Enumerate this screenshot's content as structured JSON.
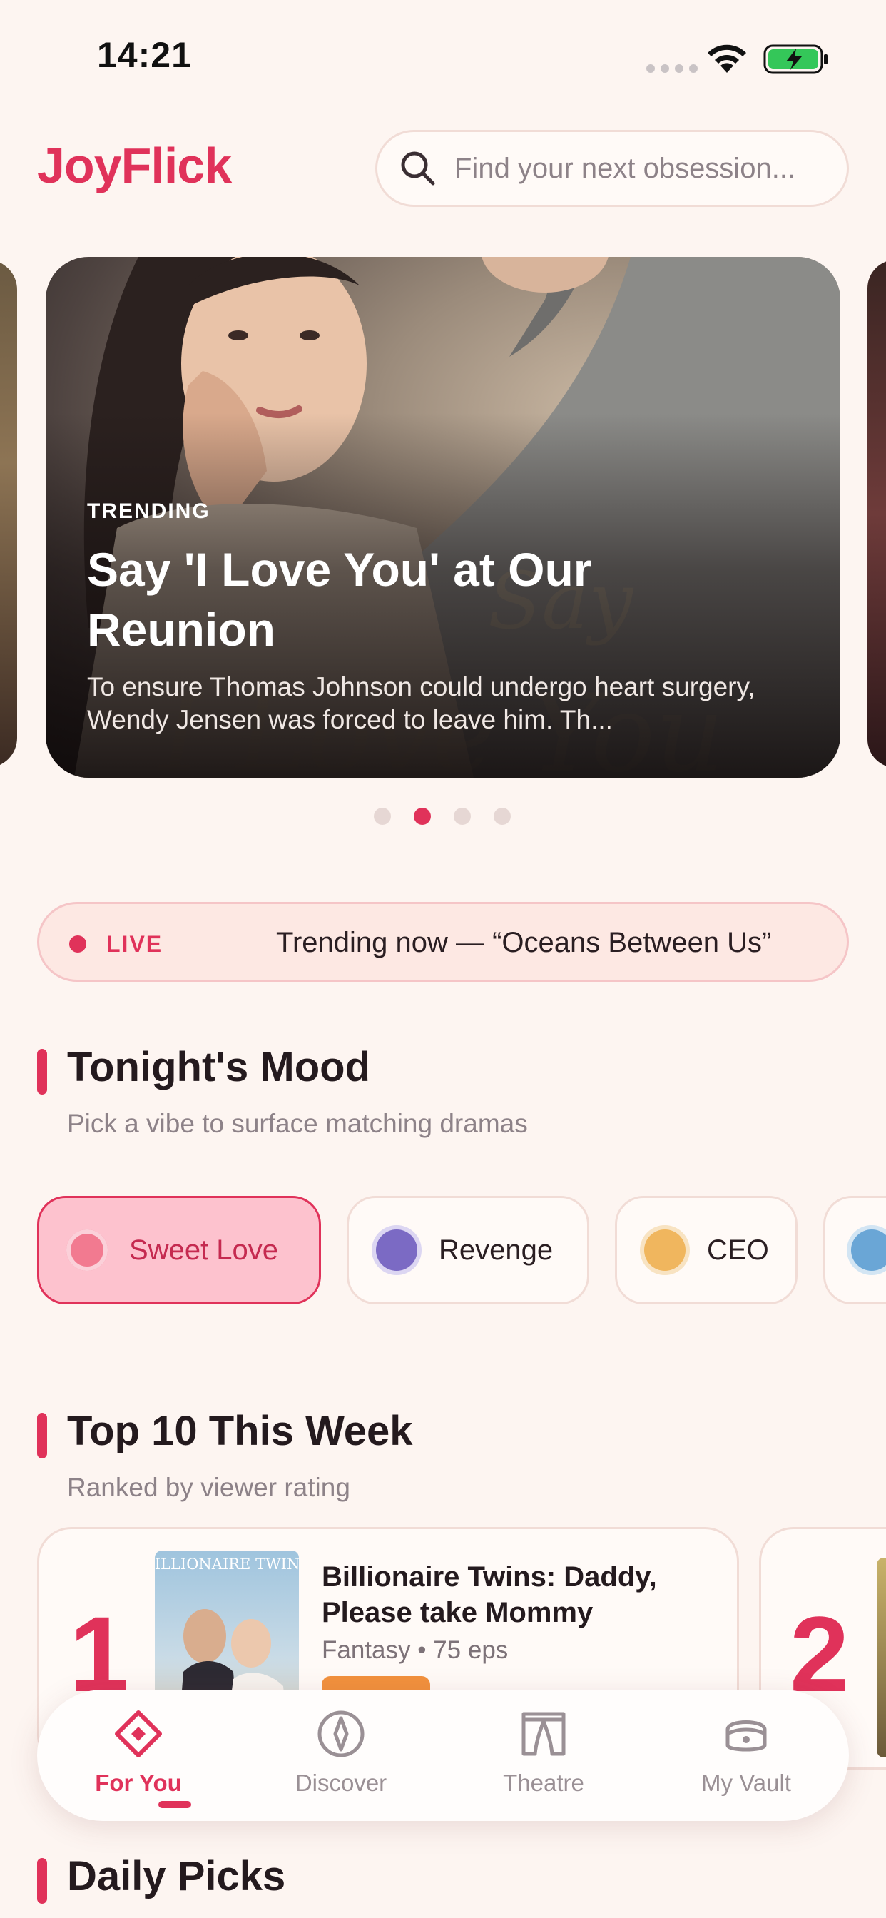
{
  "status_bar": {
    "time": "14:21"
  },
  "header": {
    "logo": "JoyFlick",
    "search_placeholder": "Find your next obsession..."
  },
  "hero": {
    "tag": "TRENDING",
    "title": "Say 'I Love You' at Our Reunion",
    "description": "To ensure Thomas Johnson could undergo heart surgery, Wendy Jensen was forced to leave him. Th...",
    "active_slide": 2,
    "slide_count": 4
  },
  "live": {
    "label": "LIVE",
    "text": "Trending now — “Oceans Between Us”"
  },
  "mood": {
    "title": "Tonight's Mood",
    "subtitle": "Pick a vibe to surface matching dramas",
    "chips": [
      {
        "label": "Sweet Love",
        "color": "#f27a90",
        "selected": true
      },
      {
        "label": "Revenge",
        "color": "#7b6ac4",
        "selected": false
      },
      {
        "label": "CEO",
        "color": "#f0b65e",
        "selected": false
      },
      {
        "label": "",
        "color": "#6aa6d6",
        "selected": false
      }
    ]
  },
  "top10": {
    "title": "Top 10 This Week",
    "subtitle": "Ranked by viewer rating",
    "items": [
      {
        "rank": "1",
        "title": "Billionaire Twins: Daddy, Please take Mommy",
        "meta": "Fantasy • 75 eps",
        "cover_text": "BILLIONAIRE TWINS"
      },
      {
        "rank": "2"
      }
    ]
  },
  "nav": {
    "items": [
      {
        "label": "For You",
        "icon": "diamond-icon",
        "active": true
      },
      {
        "label": "Discover",
        "icon": "compass-icon",
        "active": false
      },
      {
        "label": "Theatre",
        "icon": "curtain-icon",
        "active": false
      },
      {
        "label": "My Vault",
        "icon": "vault-icon",
        "active": false
      }
    ]
  },
  "daily": {
    "title": "Daily Picks"
  },
  "colors": {
    "accent": "#e0325a",
    "background": "#fdf5f1",
    "rating": "#f2913d"
  }
}
